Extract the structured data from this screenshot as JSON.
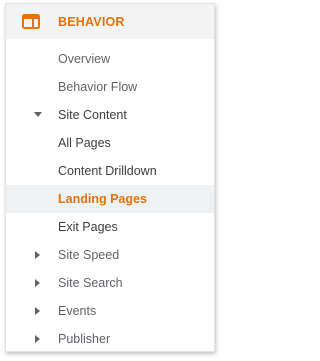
{
  "section": {
    "title": "BEHAVIOR",
    "icon": "behavior-window-icon",
    "accent_color": "#e8710a"
  },
  "nav": {
    "overview": "Overview",
    "behavior_flow": "Behavior Flow",
    "site_content": {
      "label": "Site Content",
      "expanded": true,
      "items": [
        {
          "label": "All Pages",
          "active": false
        },
        {
          "label": "Content Drilldown",
          "active": false
        },
        {
          "label": "Landing Pages",
          "active": true
        },
        {
          "label": "Exit Pages",
          "active": false
        }
      ]
    },
    "site_speed": "Site Speed",
    "site_search": "Site Search",
    "events": "Events",
    "publisher": "Publisher"
  }
}
